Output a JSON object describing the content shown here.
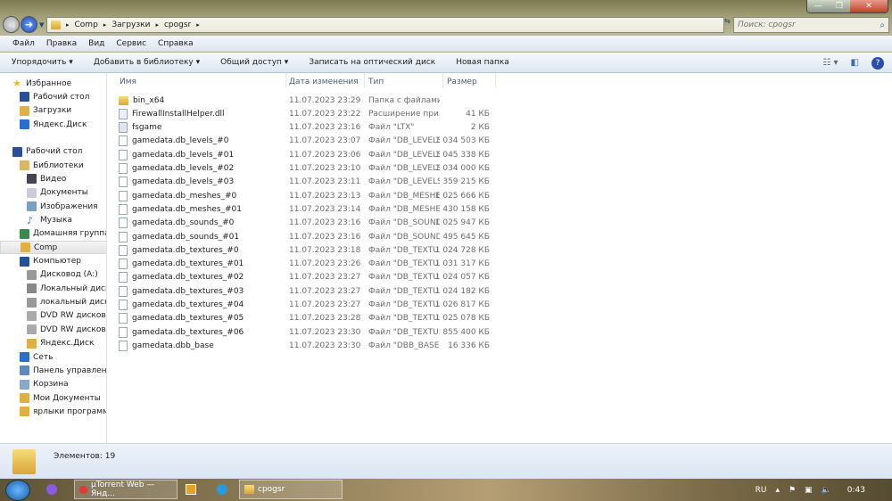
{
  "window": {
    "min": "—",
    "max": "❐",
    "close": "✕"
  },
  "address": {
    "crumbs": [
      "Comp",
      "Загрузки",
      "cpogsr"
    ]
  },
  "search": {
    "placeholder": "Поиск: cpogsr"
  },
  "menu": [
    "Файл",
    "Правка",
    "Вид",
    "Сервис",
    "Справка"
  ],
  "toolbar": {
    "organize": "Упорядочить ▾",
    "add_library": "Добавить в библиотеку ▾",
    "share": "Общий доступ ▾",
    "burn": "Записать на оптический диск",
    "new_folder": "Новая папка"
  },
  "nav": [
    {
      "label": "Избранное",
      "indent": 0,
      "icon": "star",
      "color": "#f2b81c"
    },
    {
      "label": "Рабочий стол",
      "indent": 1,
      "icon": "desktop",
      "color": "#2a4f9a"
    },
    {
      "label": "Загрузки",
      "indent": 1,
      "icon": "folder-download",
      "color": "#e0b040"
    },
    {
      "label": "Яндекс.Диск",
      "indent": 1,
      "icon": "cloud",
      "color": "#2a6fd0"
    },
    {
      "label": "",
      "indent": 0,
      "icon": "",
      "color": ""
    },
    {
      "label": "Рабочий стол",
      "indent": 0,
      "icon": "desktop",
      "color": "#2a4f9a"
    },
    {
      "label": "Библиотеки",
      "indent": 1,
      "icon": "library",
      "color": "#d8b860"
    },
    {
      "label": "Видео",
      "indent": 2,
      "icon": "video",
      "color": "#445"
    },
    {
      "label": "Документы",
      "indent": 2,
      "icon": "document",
      "color": "#ccd"
    },
    {
      "label": "Изображения",
      "indent": 2,
      "icon": "image",
      "color": "#7aa0c0"
    },
    {
      "label": "Музыка",
      "indent": 2,
      "icon": "music",
      "color": "#3a7ad0"
    },
    {
      "label": "Домашняя группа",
      "indent": 1,
      "icon": "homegroup",
      "color": "#3a8a4a"
    },
    {
      "label": "Comp",
      "indent": 1,
      "icon": "user-folder",
      "color": "#e0b040",
      "selected": true
    },
    {
      "label": "Компьютер",
      "indent": 1,
      "icon": "computer",
      "color": "#2a4f9a"
    },
    {
      "label": "Дисковод (A:)",
      "indent": 2,
      "icon": "floppy",
      "color": "#999"
    },
    {
      "label": "Локальный диск (С",
      "indent": 2,
      "icon": "hdd",
      "color": "#888"
    },
    {
      "label": "локальный диск(Д",
      "indent": 2,
      "icon": "hdd",
      "color": "#999"
    },
    {
      "label": "DVD RW дисковод",
      "indent": 2,
      "icon": "dvd",
      "color": "#aaa"
    },
    {
      "label": "DVD RW дисковод",
      "indent": 2,
      "icon": "dvd",
      "color": "#aaa"
    },
    {
      "label": "Яндекс.Диск",
      "indent": 2,
      "icon": "folder",
      "color": "#e0b040"
    },
    {
      "label": "Сеть",
      "indent": 1,
      "icon": "network",
      "color": "#2a6fd0"
    },
    {
      "label": "Панель управления",
      "indent": 1,
      "icon": "control-panel",
      "color": "#5a8ac0"
    },
    {
      "label": "Корзина",
      "indent": 1,
      "icon": "recycle-bin",
      "color": "#8aa8c8"
    },
    {
      "label": "Мои Документы",
      "indent": 1,
      "icon": "folder",
      "color": "#e0b040"
    },
    {
      "label": "ярлыки программ",
      "indent": 1,
      "icon": "folder",
      "color": "#e0b040"
    }
  ],
  "columns": [
    "Имя",
    "Дата изменения",
    "Тип",
    "Размер"
  ],
  "files": [
    {
      "name": "bin_x64",
      "date": "11.07.2023 23:29",
      "type": "Папка с файлами",
      "size": "",
      "icon": "folder"
    },
    {
      "name": "FirewallInstallHelper.dll",
      "date": "11.07.2023 23:22",
      "type": "Расширение при...",
      "size": "41 КБ",
      "icon": "dll"
    },
    {
      "name": "fsgame",
      "date": "11.07.2023 23:16",
      "type": "Файл \"LTX\"",
      "size": "2 КБ",
      "icon": "text"
    },
    {
      "name": "gamedata.db_levels_#0",
      "date": "11.07.2023 23:07",
      "type": "Файл \"DB_LEVELS...",
      "size": "1 034 503 КБ",
      "icon": "file"
    },
    {
      "name": "gamedata.db_levels_#01",
      "date": "11.07.2023 23:06",
      "type": "Файл \"DB_LEVELS...",
      "size": "1 045 338 КБ",
      "icon": "file"
    },
    {
      "name": "gamedata.db_levels_#02",
      "date": "11.07.2023 23:10",
      "type": "Файл \"DB_LEVELS...",
      "size": "1 034 000 КБ",
      "icon": "file"
    },
    {
      "name": "gamedata.db_levels_#03",
      "date": "11.07.2023 23:11",
      "type": "Файл \"DB_LEVELS...",
      "size": "359 215 КБ",
      "icon": "file"
    },
    {
      "name": "gamedata.db_meshes_#0",
      "date": "11.07.2023 23:13",
      "type": "Файл \"DB_MESHE...",
      "size": "1 025 666 КБ",
      "icon": "file"
    },
    {
      "name": "gamedata.db_meshes_#01",
      "date": "11.07.2023 23:14",
      "type": "Файл \"DB_MESHE...",
      "size": "430 158 КБ",
      "icon": "file"
    },
    {
      "name": "gamedata.db_sounds_#0",
      "date": "11.07.2023 23:16",
      "type": "Файл \"DB_SOUND...",
      "size": "1 025 947 КБ",
      "icon": "file"
    },
    {
      "name": "gamedata.db_sounds_#01",
      "date": "11.07.2023 23:16",
      "type": "Файл \"DB_SOUND...",
      "size": "495 645 КБ",
      "icon": "file"
    },
    {
      "name": "gamedata.db_textures_#0",
      "date": "11.07.2023 23:18",
      "type": "Файл \"DB_TEXTU...",
      "size": "1 024 728 КБ",
      "icon": "file"
    },
    {
      "name": "gamedata.db_textures_#01",
      "date": "11.07.2023 23:26",
      "type": "Файл \"DB_TEXTU...",
      "size": "1 031 317 КБ",
      "icon": "file"
    },
    {
      "name": "gamedata.db_textures_#02",
      "date": "11.07.2023 23:27",
      "type": "Файл \"DB_TEXTU...",
      "size": "1 024 057 КБ",
      "icon": "file"
    },
    {
      "name": "gamedata.db_textures_#03",
      "date": "11.07.2023 23:27",
      "type": "Файл \"DB_TEXTU...",
      "size": "1 024 182 КБ",
      "icon": "file"
    },
    {
      "name": "gamedata.db_textures_#04",
      "date": "11.07.2023 23:27",
      "type": "Файл \"DB_TEXTU...",
      "size": "1 026 817 КБ",
      "icon": "file"
    },
    {
      "name": "gamedata.db_textures_#05",
      "date": "11.07.2023 23:28",
      "type": "Файл \"DB_TEXTU...",
      "size": "1 025 078 КБ",
      "icon": "file"
    },
    {
      "name": "gamedata.db_textures_#06",
      "date": "11.07.2023 23:30",
      "type": "Файл \"DB_TEXTU...",
      "size": "855 400 КБ",
      "icon": "file"
    },
    {
      "name": "gamedata.dbb_base",
      "date": "11.07.2023 23:30",
      "type": "Файл \"DBB_BASE\"",
      "size": "16 336 КБ",
      "icon": "file"
    }
  ],
  "status": {
    "items": "Элементов: 19"
  },
  "taskbar": {
    "utorrent": "µTorrent Web — Янд...",
    "explorer": "cpogsr",
    "lang": "RU",
    "clock": "0:43"
  }
}
